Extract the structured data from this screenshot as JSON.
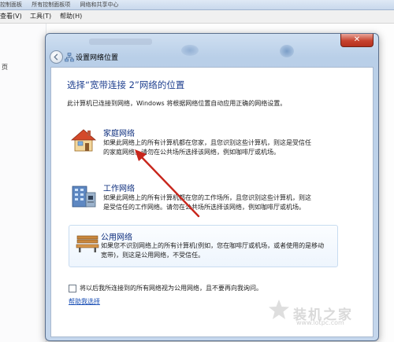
{
  "background": {
    "breadcrumb": [
      "控制面板",
      "所有控制面板项",
      "网络和共享中心"
    ],
    "menu": [
      "查看(V)",
      "工具(T)",
      "帮助(H)"
    ],
    "left_text": "页"
  },
  "dialog": {
    "title": "设置网络位置",
    "close_label": "✕",
    "heading": "选择“宽带连接 2”网络的位置",
    "description": "此计算机已连接到网络，Windows 将根据网络位置自动应用正确的网络设置。",
    "options": [
      {
        "title": "家庭网络",
        "text": "如果此网络上的所有计算机都在您家，且您识别这些计算机，则这是受信任的家庭网络。请勿在公共场所选择该网络，例如咖啡厅或机场。"
      },
      {
        "title": "工作网络",
        "text": "如果此网络上的所有计算机都在您的工作场所，且您识别这些计算机，则这是受信任的工作网络。请勿在公共场所选择该网络，例如咖啡厅或机场。"
      },
      {
        "title": "公用网络",
        "text": "如果您不识别网络上的所有计算机(例如，您在咖啡厅或机场，或者使用的是移动宽带)，则这是公用网络，不受信任。"
      }
    ],
    "checkbox_label": "将以后我所连接到的所有网络视为公用网络，且不要再向我询问。",
    "help_link": "帮助我选择"
  },
  "watermark": {
    "text": "装机之家",
    "url": "www.lotpc.com"
  },
  "colors": {
    "heading": "#1e3f8f",
    "link": "#1a4fb5",
    "annotation_arrow": "#c8261c"
  }
}
